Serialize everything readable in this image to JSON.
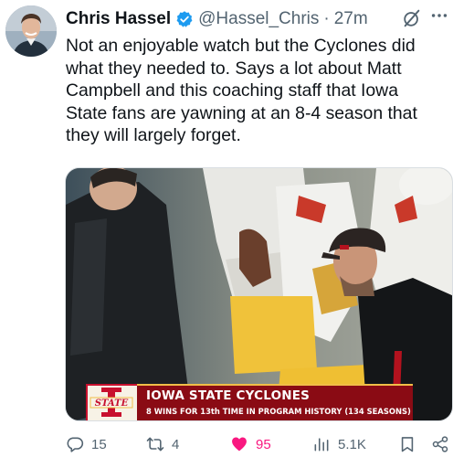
{
  "tweet": {
    "author_name": "Chris Hassel",
    "handle": "@Hassel_Chris",
    "separator": "·",
    "time": "27m",
    "text_lines": [
      "Not an enjoyable watch but the Cyclones did",
      "what they needed to. Says a lot about Matt",
      "Campbell and this coaching staff that Iowa",
      "State fans are yawning at an 8-4 season that",
      "they will largely forget."
    ]
  },
  "media": {
    "lower_third": {
      "logo_text": "STATE",
      "title": "IOWA STATE CYCLONES",
      "subtitle": "8 WINS FOR 13th TIME IN PROGRAM HISTORY (134 SEASONS)"
    }
  },
  "actions": {
    "replies": "15",
    "reposts": "4",
    "likes": "95",
    "views": "5.1K"
  },
  "colors": {
    "text": "#0f1419",
    "secondary": "#536471",
    "verified": "#1d9bf0",
    "like": "#f91880",
    "banner": "#8a0b14",
    "banner_accent": "#f1be48"
  },
  "icons": [
    "verified-badge-icon",
    "grok-icon",
    "more-icon",
    "reply-icon",
    "repost-icon",
    "like-icon",
    "views-icon",
    "bookmark-icon",
    "share-icon"
  ]
}
